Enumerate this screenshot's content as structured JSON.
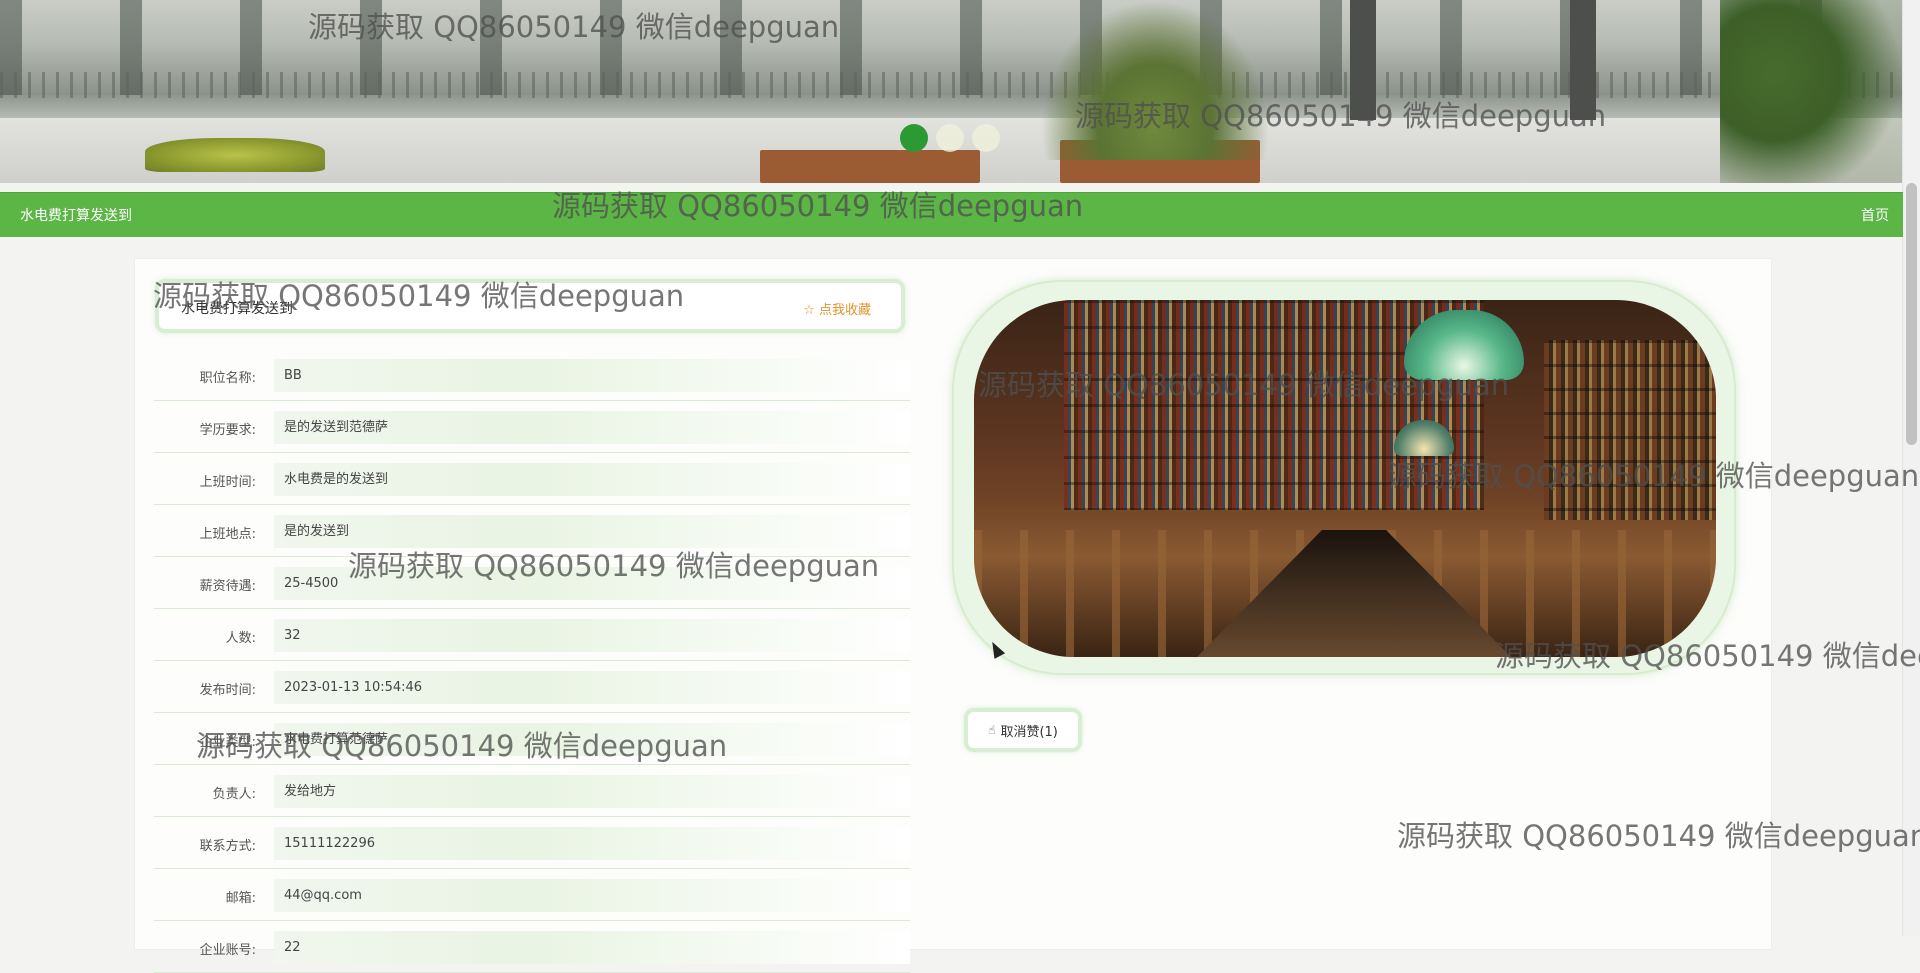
{
  "banner": {
    "slides": 3,
    "active_slide": 1
  },
  "nav": {
    "site_name": "水电费打算发送到",
    "home": "首页"
  },
  "detail": {
    "title": "水电费打算发送到",
    "favorite_label": "☆ 点我收藏",
    "fields": [
      {
        "label": "职位名称:",
        "value": "BB"
      },
      {
        "label": "学历要求:",
        "value": "是的发送到范德萨"
      },
      {
        "label": "上班时间:",
        "value": "水电费是的发送到"
      },
      {
        "label": "上班地点:",
        "value": "是的发送到"
      },
      {
        "label": "薪资待遇:",
        "value": "25-4500"
      },
      {
        "label": "人数:",
        "value": "32"
      },
      {
        "label": "发布时间:",
        "value": "2023-01-13 10:54:46"
      },
      {
        "label": "企业类型:",
        "value": "水电费打算范德萨"
      },
      {
        "label": "负责人:",
        "value": "发给地方"
      },
      {
        "label": "联系方式:",
        "value": "15111122296"
      },
      {
        "label": "邮箱:",
        "value": "44@qq.com"
      },
      {
        "label": "企业账号:",
        "value": "22"
      }
    ],
    "like_button": "取消赞(1)"
  },
  "watermark_text": "源码获取 QQ86050149 微信deepguan",
  "colors": {
    "nav_green": "#5cb646",
    "favorite_orange": "#e2932b",
    "dot_active": "#2c9a32"
  }
}
